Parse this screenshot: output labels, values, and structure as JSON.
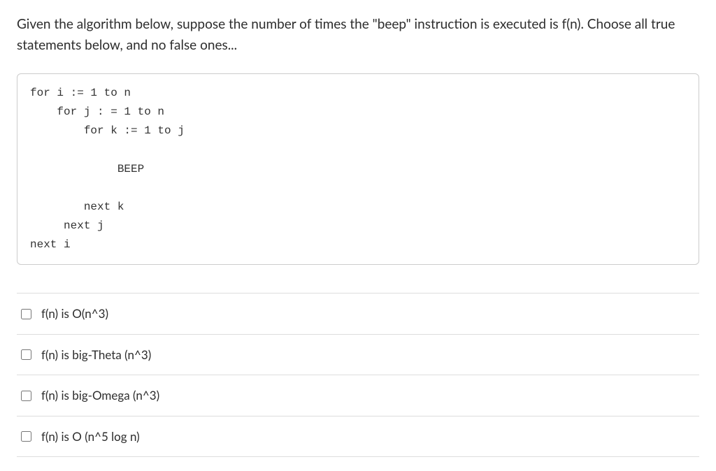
{
  "question": {
    "prompt": "Given the algorithm below, suppose the number of times the \"beep\" instruction is executed is f(n). Choose all true statements below, and no false ones..."
  },
  "code": {
    "text": "for i := 1 to n\n    for j : = 1 to n\n        for k := 1 to j\n\n             BEEP\n\n        next k\n     next j\nnext i"
  },
  "options": [
    {
      "label": "f(n) is O(n^3)"
    },
    {
      "label": "f(n) is big-Theta (n^3)"
    },
    {
      "label": "f(n) is big-Omega (n^3)"
    },
    {
      "label": "f(n) is O (n^5 log n)"
    }
  ]
}
